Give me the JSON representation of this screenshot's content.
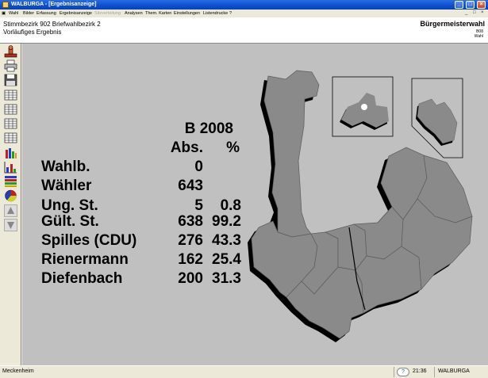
{
  "window": {
    "title": "WALBURGA - [Ergebnisanzeige]",
    "controls": [
      "_",
      "□",
      "×"
    ]
  },
  "menubar": {
    "items": [
      {
        "label": "Wahl",
        "enabled": true
      },
      {
        "label": "Bilder",
        "enabled": true
      },
      {
        "label": "Erfassung",
        "enabled": true
      },
      {
        "label": "Ergebnisanzeige",
        "enabled": true
      },
      {
        "label": "Sitzverteilung",
        "enabled": false
      },
      {
        "label": "Analysen",
        "enabled": true
      },
      {
        "label": "Them. Karten",
        "enabled": true
      },
      {
        "label": "Einstellungen",
        "enabled": true
      },
      {
        "label": "Listendrucke",
        "enabled": true
      },
      {
        "label": "?",
        "enabled": true
      }
    ],
    "mdi_controls": [
      "_",
      "□",
      "×"
    ]
  },
  "header": {
    "line1": "Stimmbezirk 902 Briefwahlbezirk 2",
    "line2": "Vorläufiges Ergebnis",
    "election": "Bürgermeisterwahl",
    "mini1": "B08",
    "mini2": "Wahl"
  },
  "toolbar": {
    "icons": [
      "stamp-icon",
      "print-icon",
      "save-icon",
      "table-grid-icon",
      "table-grid-icon",
      "table-grid-icon",
      "table-grid-icon",
      "bar-chart-icon",
      "column-chart-icon",
      "stack-chart-icon",
      "pie-chart-icon",
      "arrow-up-icon",
      "arrow-down-icon"
    ]
  },
  "results": {
    "head1": "B 2008",
    "col_abs": "Abs.",
    "col_pct": "%",
    "rows": [
      {
        "label": "Wahlb.",
        "abs": "0",
        "pct": ""
      },
      {
        "label": "Wähler",
        "abs": "643",
        "pct": ""
      },
      {
        "label": "Ung. St.",
        "abs": "5",
        "pct": "0.8"
      },
      {
        "label": "Gült. St.",
        "abs": "638",
        "pct": "99.2"
      },
      {
        "label": "Spilles (CDU)",
        "abs": "276",
        "pct": "43.3"
      },
      {
        "label": "Rienermann",
        "abs": "162",
        "pct": "25.4"
      },
      {
        "label": "Diefenbach",
        "abs": "200",
        "pct": "31.3"
      }
    ]
  },
  "colors": {
    "map_fill": "#8a8a8a",
    "map_shadow": "#000000",
    "background": "#c0c0c0",
    "titlebar": "#0a4fd0"
  },
  "statusbar": {
    "location": "Meckenheim",
    "time": "21:36",
    "app": "WALBURGA"
  }
}
